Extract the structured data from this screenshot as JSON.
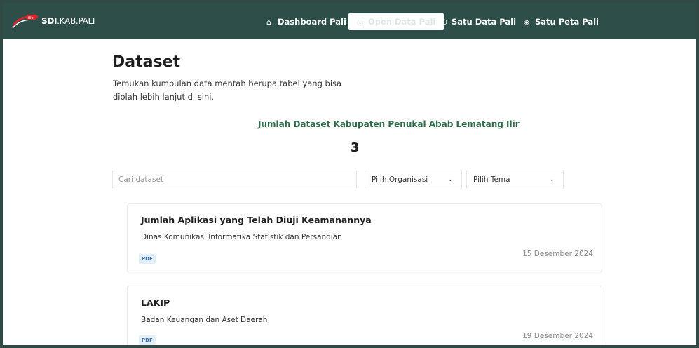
{
  "nav": {
    "logo_bold": "SDI",
    "logo_rest": ".KAB.PALI",
    "items": [
      {
        "label": "Dashboard Pali",
        "icon": "home-icon"
      },
      {
        "label": "Open Data Pali",
        "icon": "database-icon"
      },
      {
        "label": "Satu Data Pali",
        "icon": "cube-icon"
      },
      {
        "label": "Satu Peta Pali",
        "icon": "map-pin-icon"
      }
    ],
    "active_index": 1
  },
  "page": {
    "title": "Dataset",
    "description": "Temukan kumpulan data mentah berupa tabel yang bisa diolah lebih lanjut di sini."
  },
  "count": {
    "label": "Jumlah Dataset Kabupaten Penukal Abab Lematang Ilir",
    "value": "3"
  },
  "filters": {
    "search_placeholder": "Cari dataset",
    "organization_label": "Pilih Organisasi",
    "theme_label": "Pilih Tema"
  },
  "datasets": [
    {
      "title": "Jumlah Aplikasi yang Telah Diuji Keamanannya",
      "organization": "Dinas Komunikasi Informatika Statistik dan Persandian",
      "format": "PDF",
      "date": "15 Desember 2024"
    },
    {
      "title": "LAKIP",
      "organization": "Badan Keuangan dan Aset Daerah",
      "format": "PDF",
      "date": "19 Desember 2024"
    }
  ],
  "colors": {
    "navbar": "#2e4e49",
    "count_label": "#2f6b4a",
    "badge_bg": "#e3eefb",
    "badge_text": "#3a6ea8"
  }
}
